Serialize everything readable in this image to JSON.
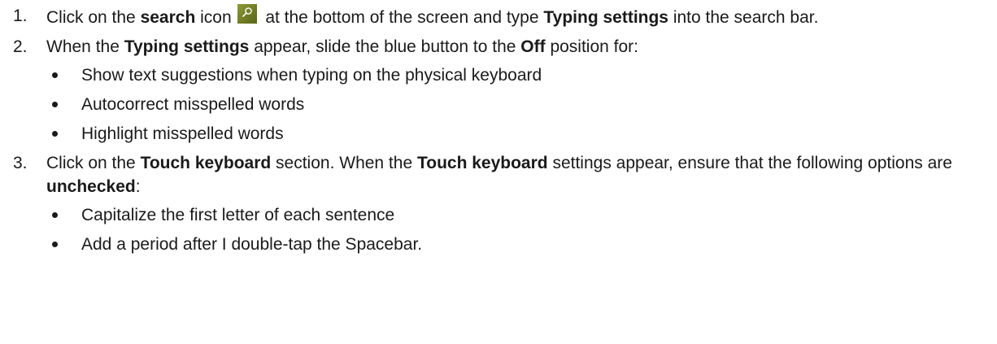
{
  "steps": [
    {
      "num": "1.",
      "parts": [
        {
          "t": "Click on the "
        },
        {
          "t": "search",
          "b": true
        },
        {
          "t": " icon "
        },
        {
          "icon": "search-icon"
        },
        {
          "t": " at the bottom of the screen and type "
        },
        {
          "t": "Typing settings",
          "b": true
        },
        {
          "t": " into the search bar."
        }
      ],
      "bullets": []
    },
    {
      "num": "2.",
      "parts": [
        {
          "t": "When the "
        },
        {
          "t": "Typing settings",
          "b": true
        },
        {
          "t": " appear, slide the blue button to the "
        },
        {
          "t": "Off",
          "b": true
        },
        {
          "t": " position for:"
        }
      ],
      "bullets": [
        "Show text suggestions when typing on the physical keyboard",
        "Autocorrect misspelled words",
        "Highlight misspelled words"
      ]
    },
    {
      "num": "3.",
      "parts": [
        {
          "t": "Click on the "
        },
        {
          "t": "Touch keyboard",
          "b": true
        },
        {
          "t": " section. When the "
        },
        {
          "t": "Touch keyboard",
          "b": true
        },
        {
          "t": " settings appear, ensure that the following options are "
        },
        {
          "t": "unchecked",
          "b": true
        },
        {
          "t": ":"
        }
      ],
      "bullets": [
        "Capitalize the first letter of each sentence",
        "Add a period after I double-tap the Spacebar."
      ]
    }
  ],
  "colors": {
    "text": "#1a1a1a",
    "search_icon_bg": "#7a8728"
  }
}
